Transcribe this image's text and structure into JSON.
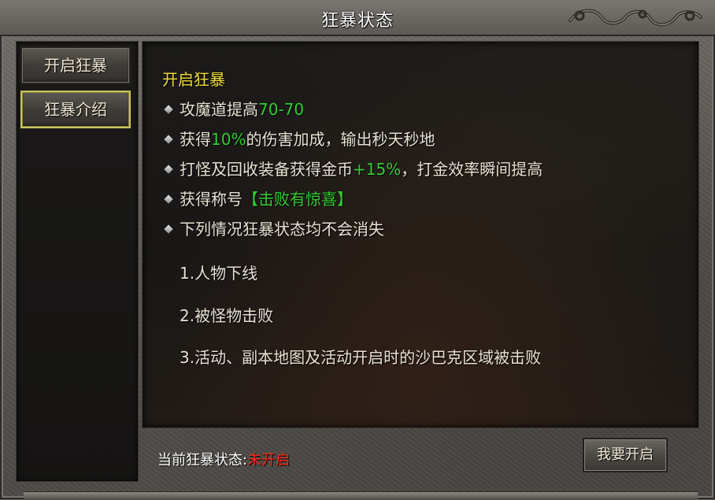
{
  "window": {
    "title": "狂暴状态"
  },
  "sidebar": {
    "tabs": [
      {
        "label": "开启狂暴",
        "active": false
      },
      {
        "label": "狂暴介绍",
        "active": true
      }
    ]
  },
  "content": {
    "title": "开启狂暴",
    "items": [
      {
        "text_a": "攻魔道提高",
        "highlight": "70-70",
        "text_b": ""
      },
      {
        "text_a": "获得",
        "highlight": "10%",
        "text_b": "的伤害加成，输出秒天秒地"
      },
      {
        "text_a": "打怪及回收装备获得金币",
        "highlight": "+15%",
        "text_b": "，打金效率瞬间提高"
      },
      {
        "text_a": "获得称号",
        "highlight": "【击败有惊喜】",
        "text_b": ""
      },
      {
        "text_a": "下列情况狂暴状态均不会消失",
        "highlight": "",
        "text_b": ""
      }
    ],
    "conditions": [
      "1.人物下线",
      "2.被怪物击败",
      "3.活动、副本地图及活动开启时的沙巴克区域被击败"
    ]
  },
  "footer": {
    "status_label": "当前狂暴状态:",
    "status_value": "未开启",
    "button_label": "我要开启"
  },
  "colors": {
    "title_yellow": "#f0dd36",
    "highlight_green": "#33cc33",
    "status_red": "#ff2a1a",
    "active_tab_border": "#c7c35b"
  },
  "icons": [
    "dragon-ornament-icon",
    "diamond-bullet-icon"
  ]
}
